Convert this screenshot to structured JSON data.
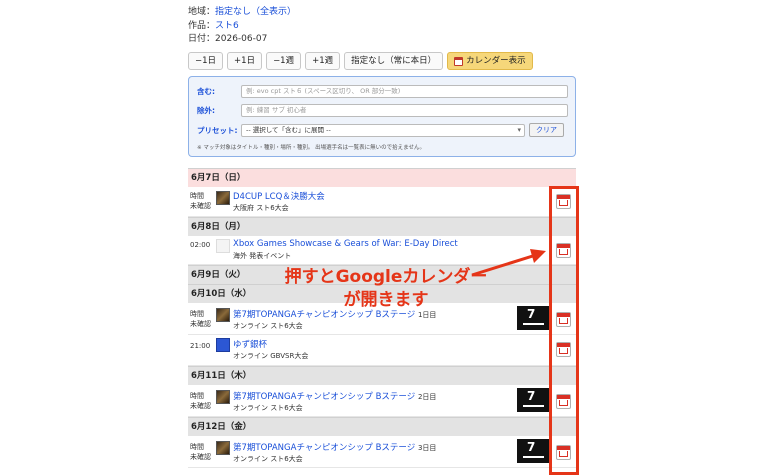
{
  "meta": {
    "region_label": "地域：",
    "region_value": "指定なし（全表示）",
    "title_label": "作品：",
    "title_value": "スト6",
    "date_label": "日付：",
    "date_value": "2026-06-07"
  },
  "nav": {
    "minus_day": "−1日",
    "plus_day": "+1日",
    "minus_week": "−1週",
    "plus_week": "+1週",
    "unset": "指定なし（常に本日）",
    "calendar_view": "カレンダー表示"
  },
  "filter": {
    "include_label": "含む:",
    "include_placeholder": "例: evo cpt スト６ (スペース区切り、 OR 部分一致)",
    "exclude_label": "除外:",
    "exclude_placeholder": "例: 練習 サブ 初心者",
    "preset_label": "プリセット:",
    "preset_value": "-- 選択して「含む」に展開 --",
    "clear_label": "クリア",
    "note": "※ マッチ対象はタイトル・種別・場所・種別。 出場選手名は一覧表に無いので拾えません。"
  },
  "days": [
    {
      "header": "6月7日（日）",
      "events": [
        {
          "time1": "時間",
          "time2": "未確認",
          "title": "D4CUP LCQ＆決勝大会",
          "sub": "大阪府 スト6大会"
        }
      ]
    },
    {
      "header": "6月8日（月）",
      "events": [
        {
          "time1": "02:00",
          "time2": "",
          "title": "Xbox Games Showcase & Gears of War: E-Day Direct",
          "sub": "海外 発表イベント"
        }
      ]
    },
    {
      "header": "6月9日（火）",
      "events": []
    },
    {
      "header": "6月10日（水）",
      "events": [
        {
          "time1": "時間",
          "time2": "未確認",
          "title": "第7期TOPANGAチャンピオンシップ Bステージ",
          "suffix": "1日目",
          "sub": "オンライン スト6大会"
        },
        {
          "time1": "21:00",
          "time2": "",
          "title": "ゆず銀杯",
          "sub": "オンライン GBVSR大会"
        }
      ]
    },
    {
      "header": "6月11日（木）",
      "events": [
        {
          "time1": "時間",
          "time2": "未確認",
          "title": "第7期TOPANGAチャンピオンシップ Bステージ",
          "suffix": "2日目",
          "sub": "オンライン スト6大会"
        }
      ]
    },
    {
      "header": "6月12日（金）",
      "events": [
        {
          "time1": "時間",
          "time2": "未確認",
          "title": "第7期TOPANGAチャンピオンシップ Bステージ",
          "suffix": "3日目",
          "sub": "オンライン スト6大会"
        }
      ]
    }
  ],
  "annotation": {
    "line1": "押すとGoogleカレンダー",
    "line2": "が開きます",
    "color": "#e53518"
  },
  "icons": {
    "calendar_add": "google-calendar-icon"
  }
}
